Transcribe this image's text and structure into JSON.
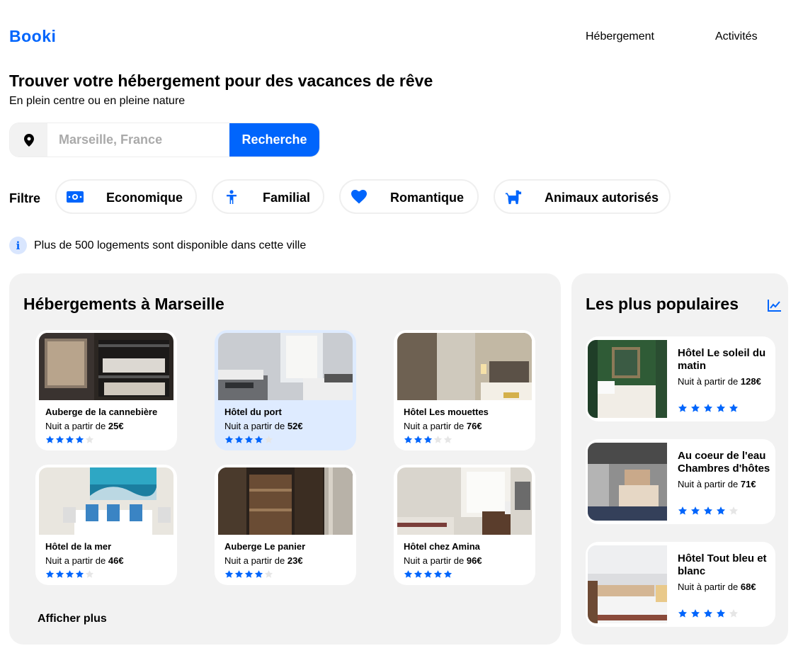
{
  "header": {
    "logo": "Booki",
    "nav": [
      "Hébergement",
      "Activités"
    ]
  },
  "hero": {
    "title": "Trouver votre hébergement pour des vacances de rêve",
    "subtitle": "En plein centre ou en pleine nature"
  },
  "search": {
    "placeholder": "Marseille, France",
    "button": "Recherche"
  },
  "filters": {
    "label": "Filtre",
    "items": [
      {
        "label": "Economique",
        "icon": "money-icon"
      },
      {
        "label": "Familial",
        "icon": "person-icon"
      },
      {
        "label": "Romantique",
        "icon": "heart-icon"
      },
      {
        "label": "Animaux autorisés",
        "icon": "dog-icon"
      }
    ]
  },
  "info": {
    "icon": "info-icon",
    "text": "Plus de 500 logements sont disponible dans cette ville"
  },
  "listings": {
    "title": "Hébergements à Marseille",
    "more": "Afficher plus",
    "price_prefix": "Nuit a partir de ",
    "cards": [
      {
        "name": "Auberge de la cannebière",
        "price": "25€",
        "rating": 4
      },
      {
        "name": "Hôtel du port",
        "price": "52€",
        "rating": 4
      },
      {
        "name": "Hôtel Les mouettes",
        "price": "76€",
        "rating": 3
      },
      {
        "name": "Hôtel de la mer",
        "price": "46€",
        "rating": 4
      },
      {
        "name": "Auberge Le panier",
        "price": "23€",
        "rating": 4
      },
      {
        "name": "Hôtel chez Amina",
        "price": "96€",
        "rating": 5
      }
    ]
  },
  "popular": {
    "title": "Les plus populaires",
    "icon": "trend-chart-icon",
    "price_prefix": "Nuit à partir de ",
    "cards": [
      {
        "name": "Hôtel Le soleil du matin",
        "price": "128€",
        "rating": 5
      },
      {
        "name": "Au coeur de l'eau Chambres d'hôtes",
        "price": "71€",
        "rating": 4
      },
      {
        "name": "Hôtel Tout bleu et blanc",
        "price": "68€",
        "rating": 4
      }
    ]
  },
  "colors": {
    "primary": "#0065FC",
    "light_blue": "#DEEBFF",
    "panel": "#F2F2F2",
    "star_off": "#E6E6E6"
  }
}
